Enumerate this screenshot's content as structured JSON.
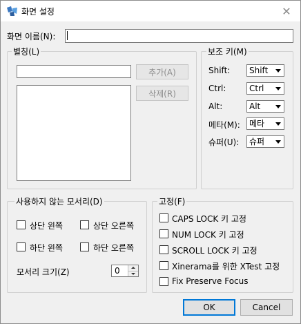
{
  "window": {
    "title": "화면 설정",
    "close_glyph": "✕",
    "icon": "app-icon",
    "accent_color": "#0078d7"
  },
  "screen_name": {
    "label": "화면 이름(N):",
    "value": ""
  },
  "alias": {
    "group_title": "별칭(L)",
    "input_value": "",
    "add_label": "추가(A)",
    "delete_label": "삭제(R)",
    "list_items": []
  },
  "modifiers": {
    "group_title": "보조 키(M)",
    "rows": [
      {
        "label": "Shift:",
        "value": "Shift"
      },
      {
        "label": "Ctrl:",
        "value": "Ctrl"
      },
      {
        "label": "Alt:",
        "value": "Alt"
      },
      {
        "label": "메타(M):",
        "value": "메타"
      },
      {
        "label": "슈퍼(U):",
        "value": "슈퍼"
      }
    ]
  },
  "dead_corners": {
    "group_title": "사용하지 않는 모서리(D)",
    "top_left": "상단 왼쪽",
    "top_right": "상단 오른쪽",
    "bottom_left": "하단 왼쪽",
    "bottom_right": "하단 오른쪽",
    "size_label": "모서리 크기(Z)",
    "size_value": "0"
  },
  "fixes": {
    "group_title": "고정(F)",
    "items": [
      "CAPS LOCK 키 고정",
      "NUM LOCK 키 고정",
      "SCROLL LOCK 키 고정",
      "Xinerama를 위한 XTest 고정",
      "Fix Preserve Focus"
    ]
  },
  "footer": {
    "ok_label": "OK",
    "cancel_label": "Cancel"
  }
}
